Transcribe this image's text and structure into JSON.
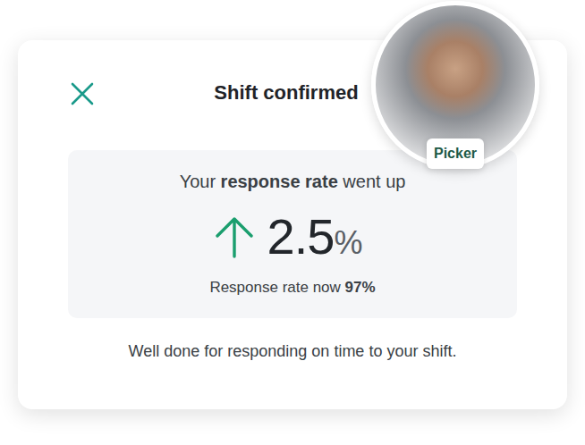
{
  "dialog": {
    "title": "Shift confirmed",
    "avatar": {
      "badge": "Picker"
    },
    "stat": {
      "headline_parts": [
        {
          "text": "Your ",
          "bold": false
        },
        {
          "text": "response rate",
          "bold": true
        },
        {
          "text": " went up",
          "bold": false
        }
      ],
      "direction": "up",
      "change": "2.5",
      "unit": "%",
      "summary_parts": [
        {
          "text": "Response rate now ",
          "bold": false
        },
        {
          "text": "97%",
          "bold": true
        }
      ]
    },
    "message": "Well done for responding on time to your shift."
  }
}
